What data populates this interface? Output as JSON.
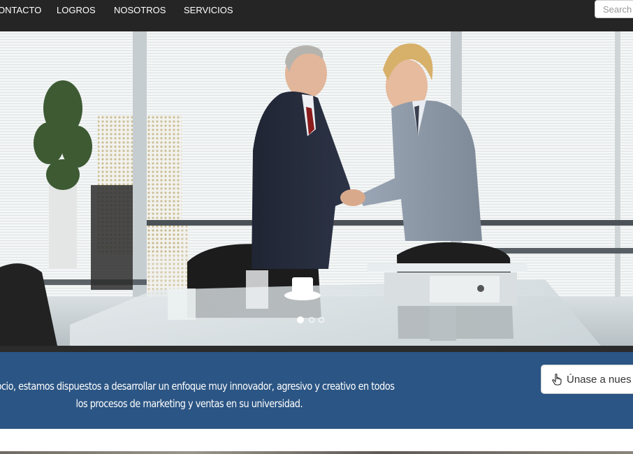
{
  "nav": {
    "links": [
      "ONTACTO",
      "LOGROS",
      "NOSOTROS",
      "SERVICIOS"
    ],
    "search_placeholder": "Search"
  },
  "carousel": {
    "image": "business-handshake-photo",
    "indicators": {
      "count": 3,
      "active": 0
    }
  },
  "cta": {
    "text_line1": "u socio, estamos dispuestos a desarrollar un enfoque muy innovador, agresivo y creativo en todos",
    "text_line2": "los procesos de marketing y ventas en su universidad.",
    "button_label": "Únase a nues",
    "button_icon": "hand-pointer-icon"
  },
  "colors": {
    "navbar": "#252525",
    "cta_band": "#2b5584"
  }
}
